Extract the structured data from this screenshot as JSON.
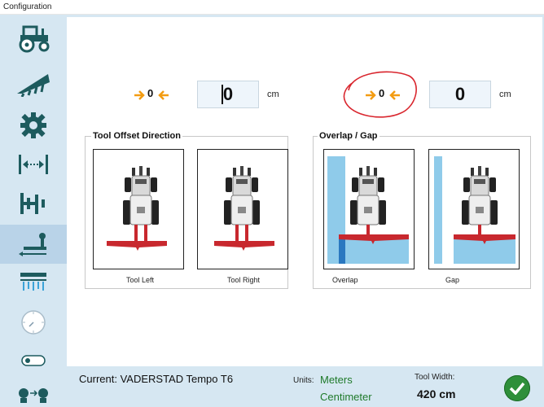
{
  "window": {
    "title": "Configuration"
  },
  "sidebar": {
    "items": [
      {
        "name": "tractor-icon"
      },
      {
        "name": "implement-icon"
      },
      {
        "name": "gear-icon"
      },
      {
        "name": "width-icon"
      },
      {
        "name": "tool-offset-icon"
      },
      {
        "name": "offset-direction-icon",
        "active": true
      },
      {
        "name": "boom-sections-icon"
      },
      {
        "name": "clock-icon"
      },
      {
        "name": "toggle-icon"
      },
      {
        "name": "machines-icon"
      }
    ]
  },
  "offset": {
    "indicator": "0",
    "value": "0",
    "unit": "cm"
  },
  "overlap": {
    "indicator": "0",
    "value": "0",
    "unit": "cm"
  },
  "tool_offset_direction": {
    "title": "Tool Offset Direction",
    "left_label": "Tool Left",
    "right_label": "Tool Right"
  },
  "overlap_gap": {
    "title": "Overlap / Gap",
    "overlap_label": "Overlap",
    "gap_label": "Gap"
  },
  "footer": {
    "current": "Current: VADERSTAD Tempo T6",
    "units_label": "Units:",
    "unit_primary": "Meters",
    "unit_secondary": "Centimeter",
    "tool_width_label": "Tool Width:",
    "tool_width_value": "420 cm"
  },
  "colors": {
    "teal": "#1d5b5e",
    "accent_orange": "#f39c12",
    "implement_red": "#c8282e",
    "overlap_blue": "#8fcbea",
    "unit_green": "#1f7a2a",
    "ok_green": "#2e8f3a",
    "annotation_red": "#d9262e"
  }
}
